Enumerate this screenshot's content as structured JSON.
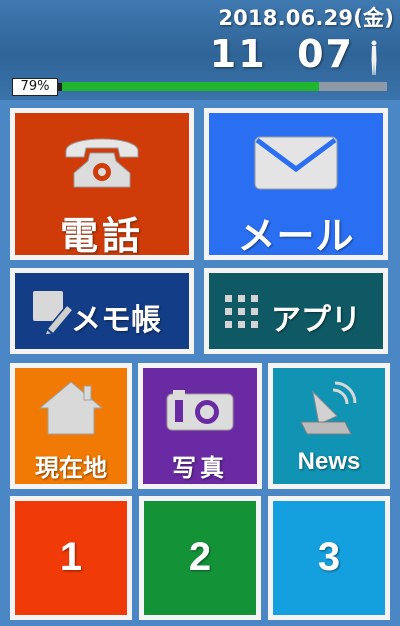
{
  "status": {
    "date": "2018.06.29(金)",
    "time": "11  07",
    "battery_label": "79%",
    "battery_level": 0.79
  },
  "tiles": {
    "phone": {
      "label": "電話",
      "icon": "telephone-icon",
      "color": "#cf3b09"
    },
    "mail": {
      "label": "メール",
      "icon": "envelope-icon",
      "color": "#2a6ff2"
    },
    "memo": {
      "label": "メモ帳",
      "icon": "memo-pencil-icon",
      "color": "#133d86"
    },
    "apps": {
      "label": "アプリ",
      "icon": "app-grid-icon",
      "color": "#0f5965"
    },
    "location": {
      "label": "現在地",
      "icon": "house-icon",
      "color": "#f17a04"
    },
    "photo": {
      "label": "写真",
      "icon": "camera-icon",
      "color": "#6a2aa3"
    },
    "news": {
      "label": "News",
      "icon": "satellite-dish-icon",
      "color": "#1193b3"
    },
    "shortcut1": {
      "label": "1",
      "color": "#f03b08"
    },
    "shortcut2": {
      "label": "2",
      "color": "#149238"
    },
    "shortcut3": {
      "label": "3",
      "color": "#14a0df"
    }
  }
}
